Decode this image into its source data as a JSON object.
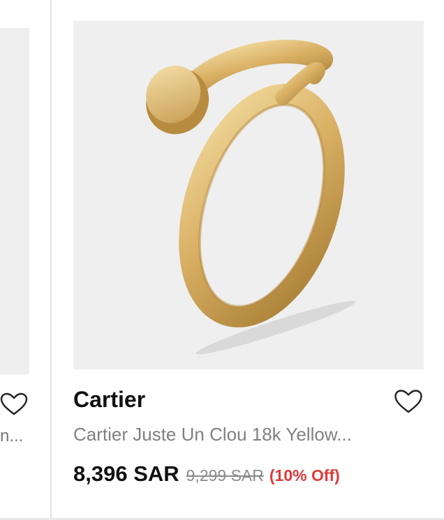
{
  "left_card": {
    "description_fragment": "n...",
    "wishlist_icon": "heart-outline-icon"
  },
  "product": {
    "brand": "Cartier",
    "title": "Cartier Juste Un Clou 18k Yellow...",
    "price": "8,396 SAR",
    "original_price": "9,299 SAR",
    "discount": "(10% Off)",
    "image_icon": "ring-image",
    "wishlist_icon": "heart-outline-icon"
  },
  "colors": {
    "discount": "#e03a3a",
    "image_background": "#efefef",
    "gold": "#d9b064"
  }
}
